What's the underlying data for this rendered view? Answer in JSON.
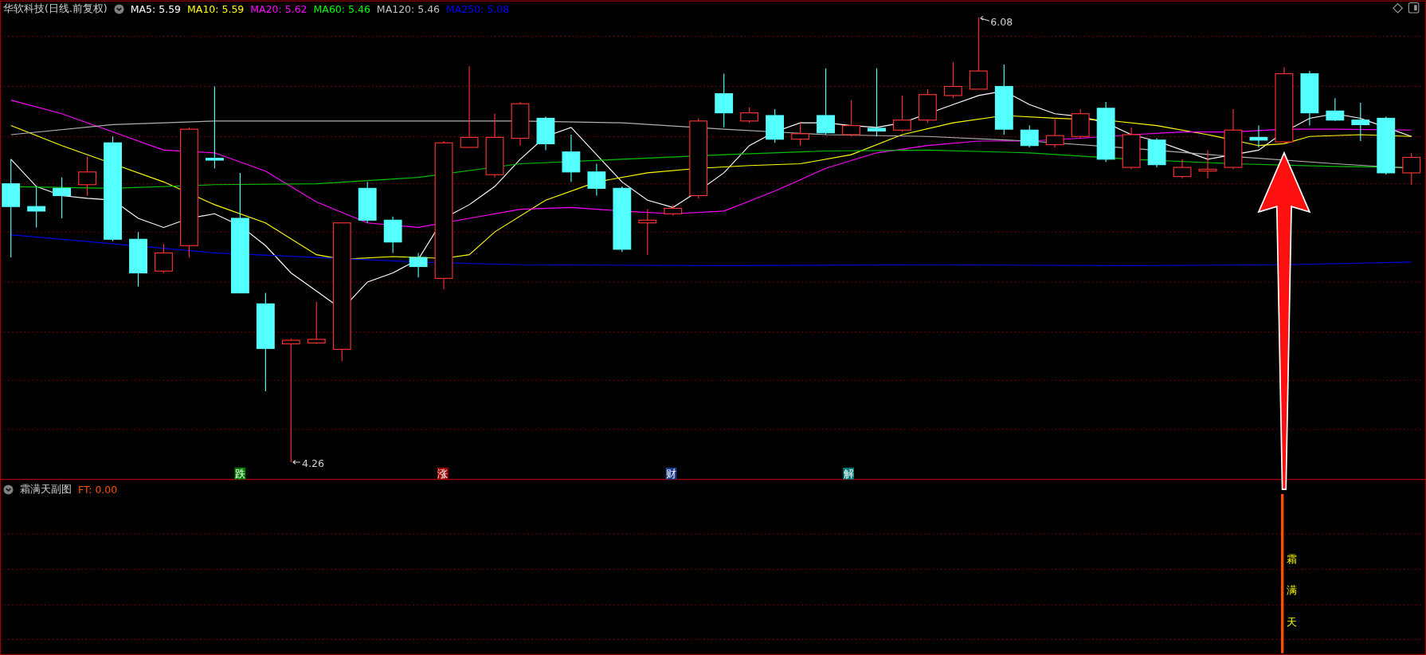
{
  "main_panel": {
    "title": "华软科技(日线.前复权)",
    "indicators": [
      {
        "label": "MA5: 5.59",
        "color": "#ffffff"
      },
      {
        "label": "MA10: 5.59",
        "color": "#ffff00"
      },
      {
        "label": "MA20: 5.62",
        "color": "#ff00ff"
      },
      {
        "label": "MA60: 5.46",
        "color": "#00ff00"
      },
      {
        "label": "MA120: 5.46",
        "color": "#c0c0c0"
      },
      {
        "label": "MA250: 5.08",
        "color": "#0000ff"
      }
    ],
    "price_labels": [
      {
        "kind": "high",
        "text": "6.08"
      },
      {
        "kind": "low",
        "text": "4.26"
      }
    ],
    "event_markers": [
      {
        "text": "跌",
        "color": "#008000"
      },
      {
        "text": "涨",
        "color": "#a00000"
      },
      {
        "text": "财",
        "color": "#1e3c8c"
      },
      {
        "text": "解",
        "color": "#007878"
      }
    ]
  },
  "sub_panel": {
    "title": "霜满天副图",
    "indicators": [
      {
        "label": "FT: 0.00",
        "color": "#ff5000"
      }
    ],
    "signal_text": "霜满天"
  }
}
